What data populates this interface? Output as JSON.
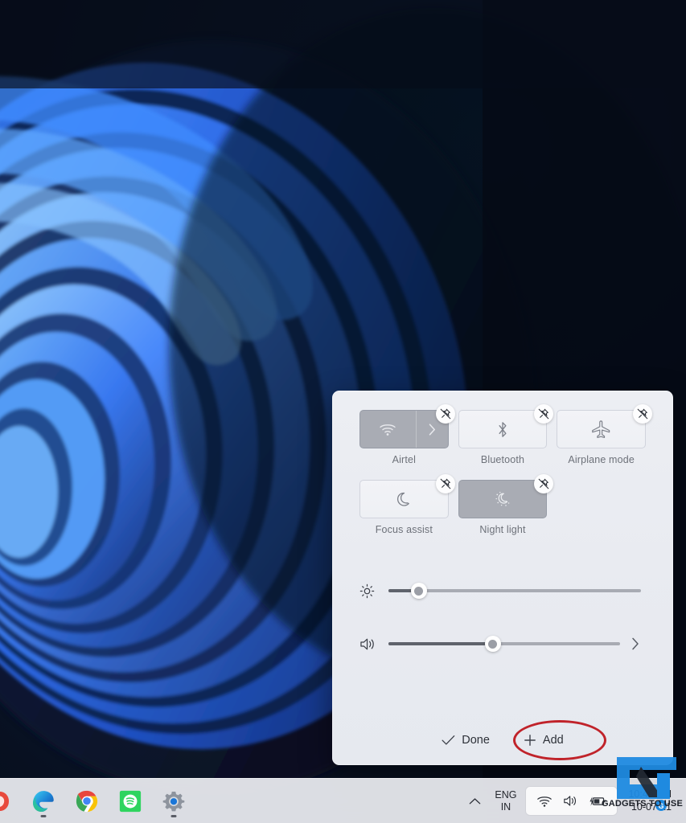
{
  "desktop": {
    "wallpaper_name": "windows-11-bloom-wallpaper",
    "background_color": "#08111f",
    "accent_color": "#2a6df4"
  },
  "quick_settings": {
    "panel_name": "Quick Settings",
    "tiles": [
      {
        "id": "wifi",
        "label": "Airtel",
        "icon": "wifi-icon",
        "state": "on",
        "has_chevron": true,
        "unpin_label": "Unpin"
      },
      {
        "id": "bluetooth",
        "label": "Bluetooth",
        "icon": "bluetooth-icon",
        "state": "off",
        "has_chevron": false,
        "unpin_label": "Unpin"
      },
      {
        "id": "airplane",
        "label": "Airplane mode",
        "icon": "airplane-icon",
        "state": "off",
        "has_chevron": false,
        "unpin_label": "Unpin"
      },
      {
        "id": "focus-assist",
        "label": "Focus assist",
        "icon": "moon-icon",
        "state": "off",
        "has_chevron": false,
        "unpin_label": "Unpin"
      },
      {
        "id": "night-light",
        "label": "Night light",
        "icon": "night-light-icon",
        "state": "on",
        "has_chevron": false,
        "unpin_label": "Unpin"
      }
    ],
    "sliders": [
      {
        "id": "brightness",
        "icon": "brightness-icon",
        "value": 12,
        "min": 0,
        "max": 100,
        "has_end_chevron": false
      },
      {
        "id": "volume",
        "icon": "volume-icon",
        "value": 45,
        "min": 0,
        "max": 100,
        "has_end_chevron": true
      }
    ],
    "footer": {
      "done_label": "Done",
      "done_icon": "checkmark-icon",
      "add_label": "Add",
      "add_icon": "plus-icon"
    },
    "annotation": {
      "shape": "ellipse",
      "color": "#c0232a",
      "target": "Add"
    }
  },
  "taskbar": {
    "apps": [
      {
        "id": "app-1",
        "name": "pinned-app-icon",
        "running": false
      },
      {
        "id": "edge",
        "name": "edge-icon",
        "running": true
      },
      {
        "id": "chrome",
        "name": "chrome-icon",
        "running": false
      },
      {
        "id": "spotify",
        "name": "spotify-icon",
        "running": false
      },
      {
        "id": "settings",
        "name": "settings-icon",
        "running": true
      }
    ],
    "chevron_label": "Show hidden icons",
    "language": {
      "line1": "ENG",
      "line2": "IN"
    },
    "tray": [
      {
        "id": "wifi",
        "name": "wifi-icon"
      },
      {
        "id": "volume",
        "name": "volume-icon"
      },
      {
        "id": "battery",
        "name": "battery-charging-icon"
      }
    ],
    "clock": {
      "time": "10:46 PM",
      "date": "10-07-21"
    }
  },
  "watermark": {
    "text": "GADGETS TO USE",
    "logo_name": "gadgetstouse-logo"
  }
}
